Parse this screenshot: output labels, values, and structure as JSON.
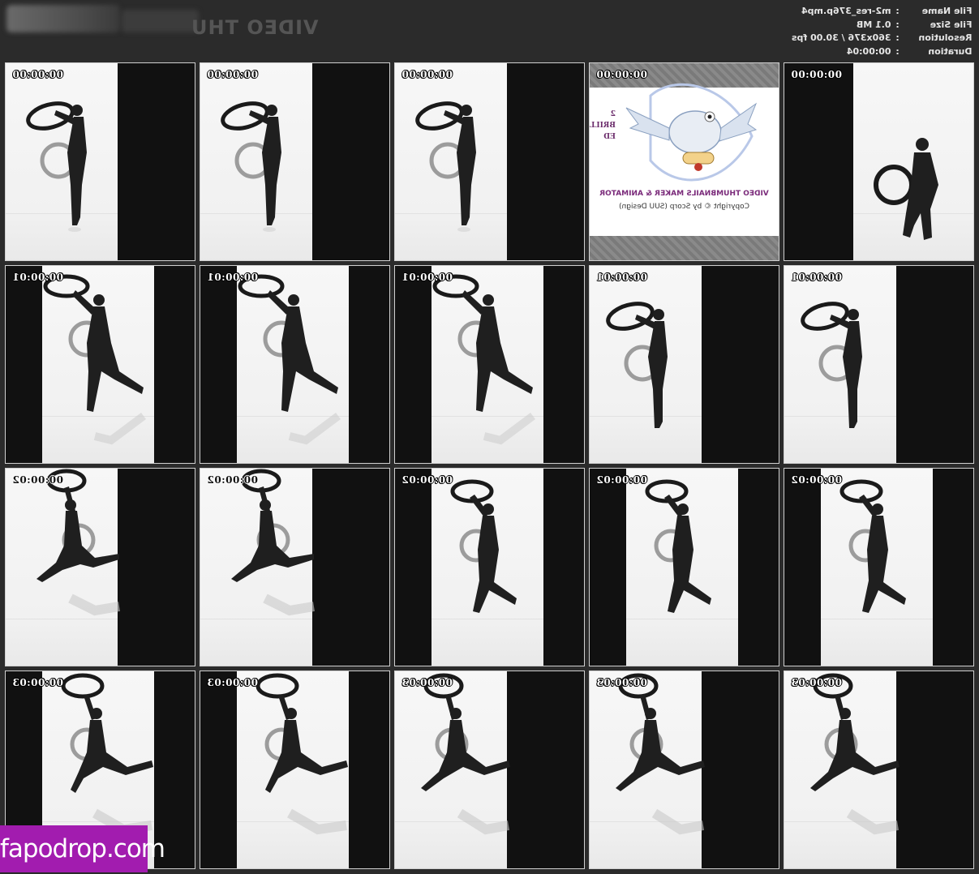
{
  "header": {
    "watermark_title": "VIDEO THU",
    "info": [
      {
        "label": "File Name",
        "sep": ":",
        "value": "m2-res_376p.mp4"
      },
      {
        "label": "File Size",
        "sep": ":",
        "value": "0.1 MB"
      },
      {
        "label": "Resolution",
        "sep": ":",
        "value": "360x376 / 30.00 fps"
      },
      {
        "label": "Duration",
        "sep": ":",
        "value": "00:00:04"
      }
    ]
  },
  "thumbnails": [
    {
      "timestamp": "00:00:00"
    },
    {
      "timestamp": "00:00:00"
    },
    {
      "timestamp": "00:00:00"
    },
    {
      "timestamp": "00:00:00"
    },
    {
      "timestamp": "00:00:00"
    },
    {
      "timestamp": "00:00:01"
    },
    {
      "timestamp": "00:00:01"
    },
    {
      "timestamp": "00:00:01"
    },
    {
      "timestamp": "00:00:01"
    },
    {
      "timestamp": "00:00:01"
    },
    {
      "timestamp": "00:00:02"
    },
    {
      "timestamp": "00:00:02"
    },
    {
      "timestamp": "00:00:02"
    },
    {
      "timestamp": "00:00:02"
    },
    {
      "timestamp": "00:00:02"
    },
    {
      "timestamp": "00:00:03"
    },
    {
      "timestamp": "00:00:03"
    },
    {
      "timestamp": "00:00:03"
    },
    {
      "timestamp": "00:00:03"
    },
    {
      "timestamp": "00:00:03"
    }
  ],
  "promo": {
    "line1": "VIDEO THUMBNAILS MAKER & ANIMATOR",
    "line2": "Copyright © by Scorp (SUU Design)",
    "side_lines": [
      "2",
      "BRILL",
      "ED"
    ]
  },
  "watermark_badge": "fapodrop.com",
  "colors": {
    "background": "#2b2b2b",
    "frame_white": "#f2f2f2",
    "frame_black": "#111111",
    "badge": "#a21caf"
  }
}
